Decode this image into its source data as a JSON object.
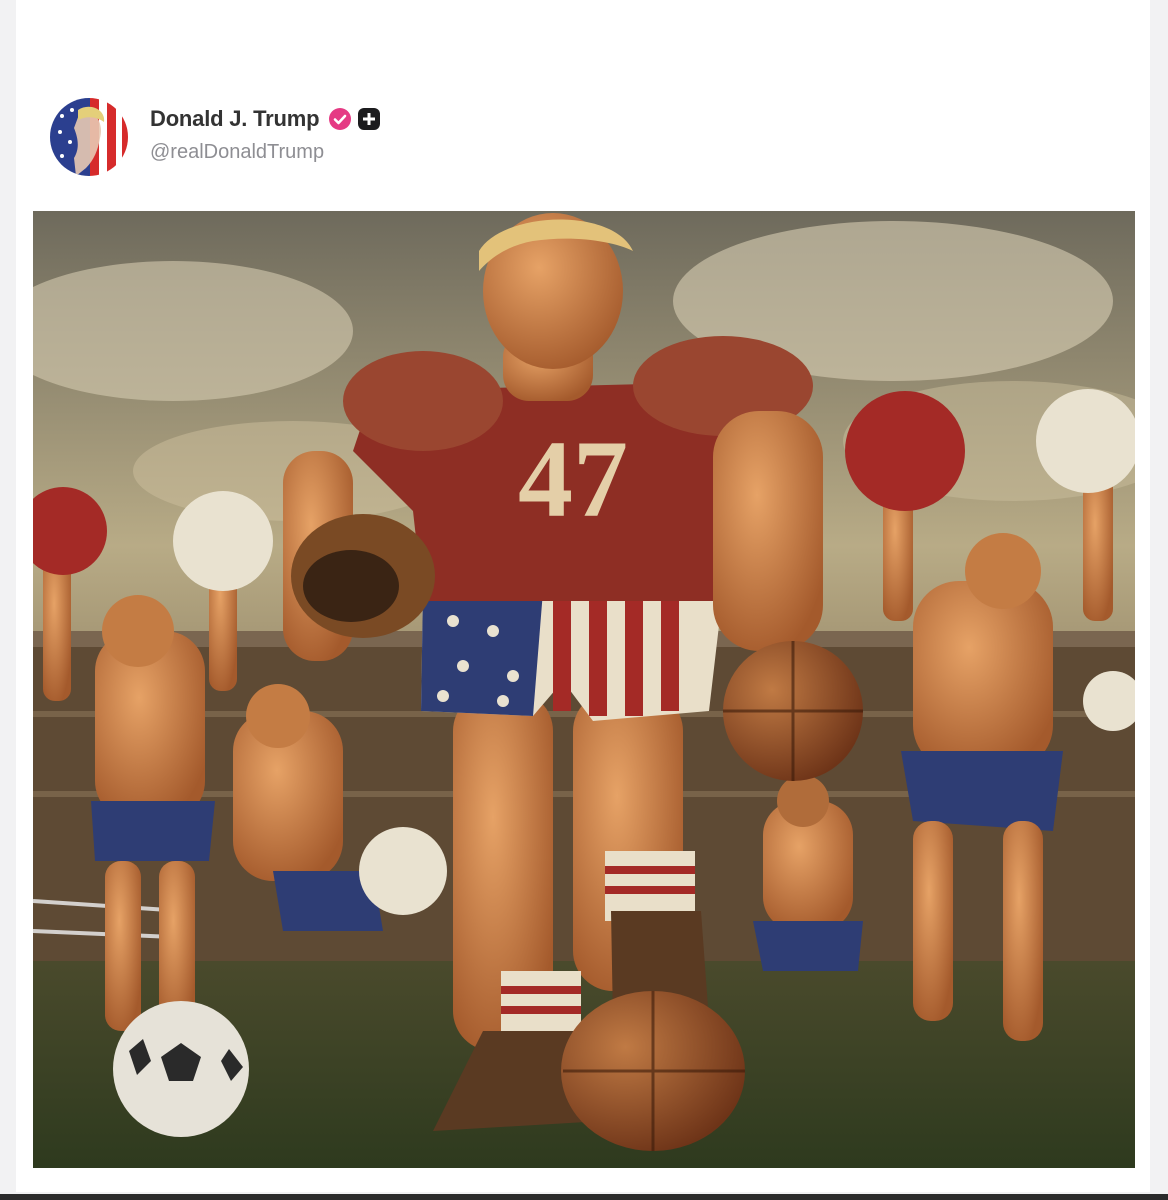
{
  "post": {
    "author": {
      "display_name": "Donald J. Trump",
      "handle": "@realDonaldTrump",
      "avatar_icon": "flag-portrait-avatar",
      "verified_icon": "verified-badge-icon",
      "extra_icon": "plus-square-icon"
    },
    "image": {
      "jersey_number": "47",
      "description_icon": "painting-image"
    }
  },
  "colors": {
    "verified": "#e53a84",
    "name_text": "#333333",
    "handle_text": "#8e8e93"
  }
}
